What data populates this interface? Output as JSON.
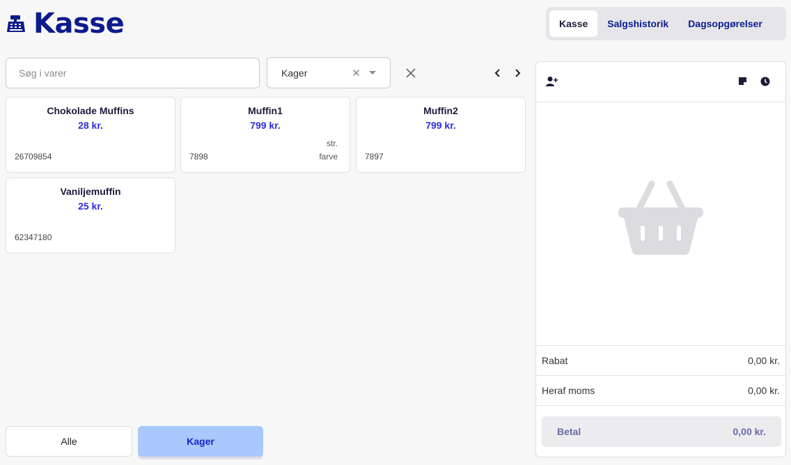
{
  "header": {
    "title": "Kasse",
    "logo_icon": "cash-register-icon",
    "brand_color": "#0d1b8c"
  },
  "nav": {
    "tabs": [
      {
        "label": "Kasse",
        "active": true
      },
      {
        "label": "Salgshistorik",
        "active": false
      },
      {
        "label": "Dagsopgørelser",
        "active": false
      }
    ]
  },
  "search": {
    "placeholder": "Søg i varer",
    "value": ""
  },
  "filter": {
    "selected": "Kager",
    "clear_icon": "close-icon",
    "caret_icon": "chevron-down-icon"
  },
  "products": [
    {
      "name": "Chokolade Muffins",
      "price": "28 kr.",
      "sku": "26709854",
      "attr1": "",
      "attr2": ""
    },
    {
      "name": "Muffin1",
      "price": "799 kr.",
      "sku": "7898",
      "attr1": "str.",
      "attr2": "farve"
    },
    {
      "name": "Muffin2",
      "price": "799 kr.",
      "sku": "7897",
      "attr1": "",
      "attr2": ""
    },
    {
      "name": "Vaniljemuffin",
      "price": "25 kr.",
      "sku": "62347180",
      "attr1": "",
      "attr2": ""
    }
  ],
  "categories": [
    {
      "label": "Alle",
      "active": false
    },
    {
      "label": "Kager",
      "active": true
    }
  ],
  "cart": {
    "discount_label": "Rabat",
    "discount_value": "0,00 kr.",
    "vat_label": "Heraf moms",
    "vat_value": "0,00 kr.",
    "pay_label": "Betal",
    "pay_value": "0,00 kr.",
    "empty_icon": "basket-icon",
    "icons": [
      "add-customer-icon",
      "note-icon",
      "clock-icon"
    ]
  },
  "colors": {
    "accent_price": "#2c2cd8",
    "active_category_bg": "#a9c8fb"
  }
}
